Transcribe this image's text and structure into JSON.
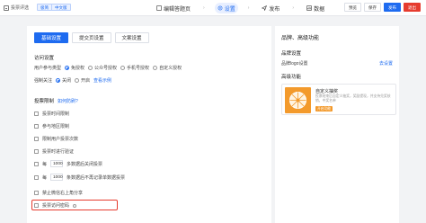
{
  "header": {
    "back_label": "投票评选",
    "tags": [
      "极简",
      "中文版"
    ],
    "steps": [
      {
        "label": "编辑答题页",
        "active": false
      },
      {
        "label": "设置",
        "active": true
      },
      {
        "label": "发布",
        "active": false
      },
      {
        "label": "数据",
        "active": false
      }
    ],
    "buttons": [
      {
        "label": "预览",
        "style": "default"
      },
      {
        "label": "保存",
        "style": "default"
      },
      {
        "label": "发布",
        "style": "primary"
      },
      {
        "label": "退出",
        "style": "danger"
      }
    ]
  },
  "tabs": [
    {
      "label": "基础设置",
      "active": true
    },
    {
      "label": "提交页设置",
      "active": false
    },
    {
      "label": "文案设置",
      "active": false
    }
  ],
  "access": {
    "title": "访问设置",
    "user_type_label": "用户参与类型",
    "user_types": [
      {
        "label": "免授权",
        "selected": true
      },
      {
        "label": "公众号授权",
        "selected": false
      },
      {
        "label": "手机号授权",
        "selected": false
      },
      {
        "label": "自定义授权",
        "selected": false
      }
    ],
    "follow_label": "强制关注",
    "follow_options": [
      {
        "label": "关闭",
        "selected": true
      },
      {
        "label": "开启",
        "selected": false
      }
    ],
    "follow_link": "查看示例"
  },
  "limits": {
    "title": "投票限制",
    "title_link": "如何防刷?",
    "items": [
      {
        "label": "投票时间限制"
      },
      {
        "label": "参与地区限制"
      },
      {
        "label": "限制用户投票次数"
      },
      {
        "label": "投票时进行验证"
      }
    ],
    "each_prefix": "每",
    "each_value": "1000",
    "each_suffix": "多数据后关闭投票",
    "each2_prefix": "每",
    "each2_value": "1000",
    "each2_suffix": "条数据后不再记录单数据投票",
    "share_label": "禁止微信右上角分享",
    "password_label": "投票访问密码"
  },
  "right": {
    "title": "品牌、高级功能",
    "brand_title": "品牌设置",
    "brand_row_label": "品牌logo设置",
    "brand_row_link": "去设置",
    "advanced_title": "高级功能",
    "card_title": "自定义抽奖",
    "card_desc": "投票结束后自定义抽奖，奖励提现，并支持兑奖核销，中奖名单",
    "card_button": "开启功能"
  },
  "colors": {
    "primary": "#1e6bf0",
    "danger": "#e63c2f",
    "card_accent": "#f39a2c"
  }
}
